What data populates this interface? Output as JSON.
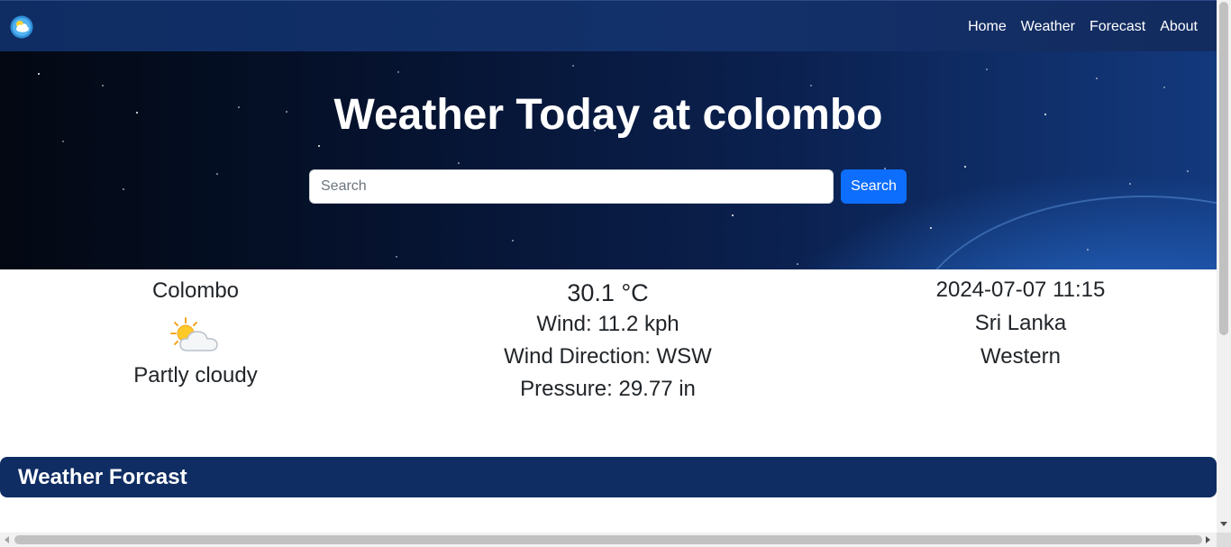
{
  "navbar": {
    "logo_icon": "weather-logo-icon",
    "links": [
      {
        "label": "Home"
      },
      {
        "label": "Weather"
      },
      {
        "label": "Forecast"
      },
      {
        "label": "About"
      }
    ],
    "background_color": "#0f2d63"
  },
  "hero": {
    "title": "Weather Today at colombo",
    "search": {
      "placeholder": "Search",
      "value": ""
    },
    "search_button_label": "Search",
    "search_button_color": "#0d6efd"
  },
  "current": {
    "city": "Colombo",
    "condition_icon": "partly-cloudy-icon",
    "condition": "Partly cloudy",
    "temperature": "30.1 °C",
    "wind": "Wind: 11.2 kph",
    "wind_direction": "Wind Direction: WSW",
    "pressure": "Pressure: 29.77 in",
    "local_time": "2024-07-07 11:15",
    "country": "Sri Lanka",
    "region": "Western"
  },
  "forecast_section": {
    "title": "Weather Forcast"
  }
}
